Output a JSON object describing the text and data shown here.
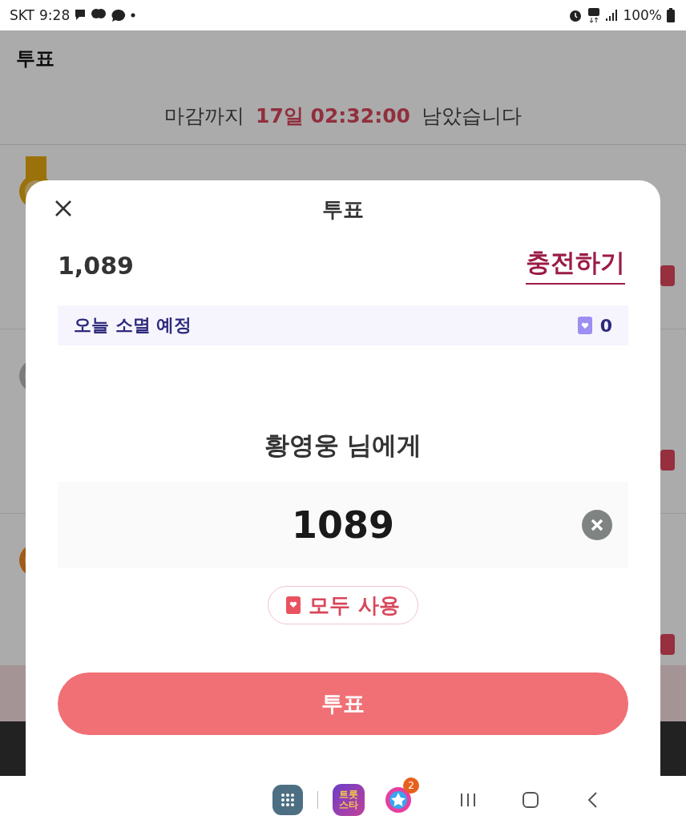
{
  "status_bar": {
    "carrier": "SKT",
    "time": "9:28",
    "battery": "100%"
  },
  "page": {
    "title": "투표",
    "deadline": {
      "prefix": "마감까지",
      "countdown": "17일 02:32:00",
      "suffix": "남았습니다"
    }
  },
  "dialog": {
    "title": "투표",
    "balance": "1,089",
    "charge_link": "충전하기",
    "expiring": {
      "label": "오늘 소멸 예정",
      "count": "0"
    },
    "recipient": "황영웅 님에게",
    "amount": "1089",
    "use_all_button": "모두 사용",
    "vote_button": "투표"
  },
  "nav_bar": {
    "app_icon_label": [
      "트롯",
      "스타"
    ],
    "badge": "2"
  }
}
